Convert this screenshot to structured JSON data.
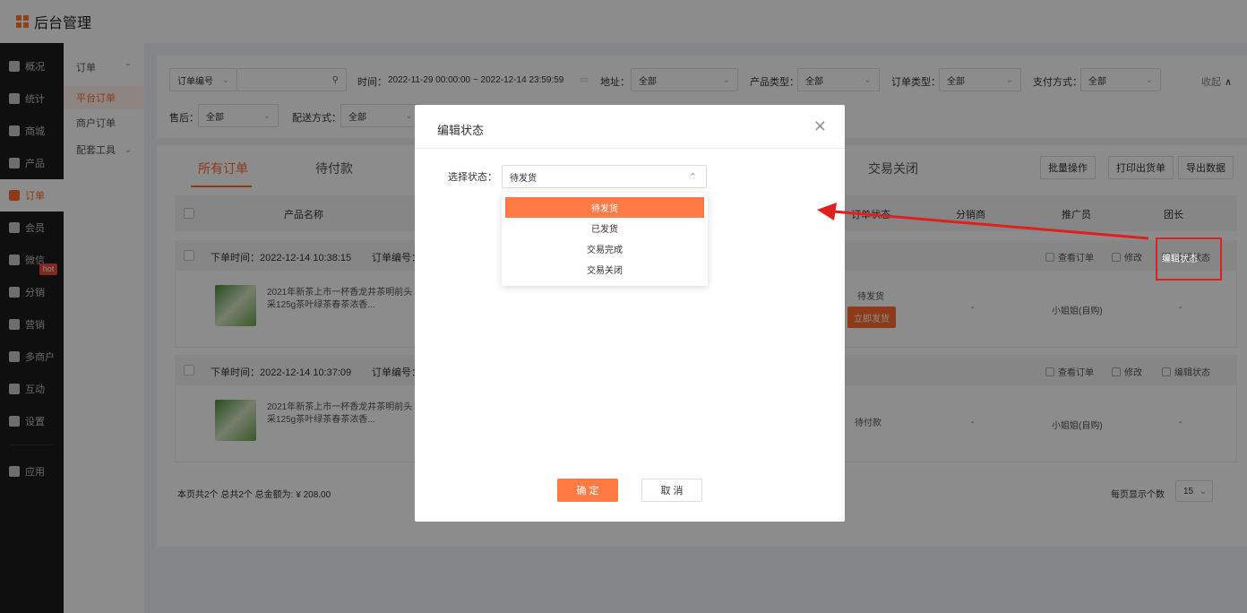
{
  "app": {
    "title": "后台管理"
  },
  "sidebar": {
    "items": [
      {
        "label": "概况"
      },
      {
        "label": "统计"
      },
      {
        "label": "商城"
      },
      {
        "label": "产品"
      },
      {
        "label": "订单"
      },
      {
        "label": "会员"
      },
      {
        "label": "微信"
      },
      {
        "label": "分销"
      },
      {
        "label": "营销"
      },
      {
        "label": "多商户"
      },
      {
        "label": "互动"
      },
      {
        "label": "设置"
      },
      {
        "label": "应用"
      }
    ],
    "hot_badge": "hot"
  },
  "subnav": {
    "group": "订单",
    "items": [
      {
        "label": "平台订单"
      },
      {
        "label": "商户订单"
      }
    ],
    "group2": "配套工具"
  },
  "filters": {
    "order_no_select": "订单编号",
    "time_label": "时间：",
    "time_value": "2022-11-29 00:00:00 ~ 2022-12-14 23:59:59",
    "address_label": "地址：",
    "address_value": "全部",
    "product_type_label": "产品类型：",
    "product_type_value": "全部",
    "order_type_label": "订单类型：",
    "order_type_value": "全部",
    "payment_label": "支付方式：",
    "payment_value": "全部",
    "collapse": "收起",
    "after_sale_label": "售后：",
    "after_sale_value": "全部",
    "delivery_label": "配送方式：",
    "delivery_value": "全部"
  },
  "tabs": [
    {
      "label": "所有订单"
    },
    {
      "label": "待付款"
    },
    {
      "label": "交易关闭"
    }
  ],
  "toolbar": {
    "batch": "批量操作",
    "print": "打印出货单",
    "export": "导出数据"
  },
  "table": {
    "headers": {
      "product_name": "产品名称",
      "order_status": "订单状态",
      "distributor": "分销商",
      "promoter": "推广员",
      "leader": "团长"
    }
  },
  "orders": [
    {
      "time": "下单时间：2022-12-14 10:38:15",
      "order_no_label": "订单编号：",
      "product": "2021年新茶上市一杯香龙井茶明前头采125g茶叶绿茶春茶浓香...",
      "status": "待发货",
      "ship_button": "立即发货",
      "distributor": "-",
      "promoter": "小姐姐(自购)",
      "leader": "-",
      "ops": {
        "view": "查看订单",
        "edit": "修改",
        "edit_status": "编辑状态"
      }
    },
    {
      "time": "下单时间：2022-12-14 10:37:09",
      "order_no_label": "订单编号：",
      "product": "2021年新茶上市一杯香龙井茶明前头采125g茶叶绿茶春茶浓香...",
      "status": "待付款",
      "distributor": "-",
      "promoter": "小姐姐(自购)",
      "leader": "-",
      "ops": {
        "view": "查看订单",
        "edit": "修改",
        "edit_status": "编辑状态"
      }
    }
  ],
  "footer": {
    "summary": "本页共2个  总共2个  总金额为: ¥ 208.00",
    "per_page_label": "每页显示个数",
    "per_page_value": "15"
  },
  "modal": {
    "title": "编辑状态",
    "field_label": "选择状态：",
    "selected": "待发货",
    "options": [
      {
        "label": "待发货"
      },
      {
        "label": "已发货"
      },
      {
        "label": "交易完成"
      },
      {
        "label": "交易关闭"
      }
    ],
    "confirm": "确 定",
    "cancel": "取 消"
  },
  "colors": {
    "accent": "#ff6a2c",
    "annotation": "#e02020"
  }
}
